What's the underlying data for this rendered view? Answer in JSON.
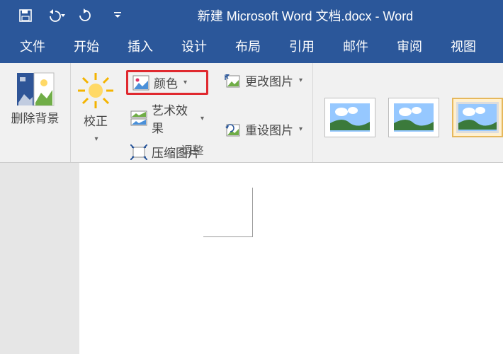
{
  "titlebar": {
    "doc_name": "新建 Microsoft Word 文档.docx",
    "sep": "  -  ",
    "app_name": "Word"
  },
  "tabs": [
    "文件",
    "开始",
    "插入",
    "设计",
    "布局",
    "引用",
    "邮件",
    "审阅",
    "视图"
  ],
  "ribbon": {
    "remove_bg": "删除背景",
    "corrections": "校正",
    "color": "颜色",
    "artistic": "艺术效果",
    "compress": "压缩图片",
    "change_pic": "更改图片",
    "reset_pic": "重设图片",
    "adjust_label": "调整"
  }
}
